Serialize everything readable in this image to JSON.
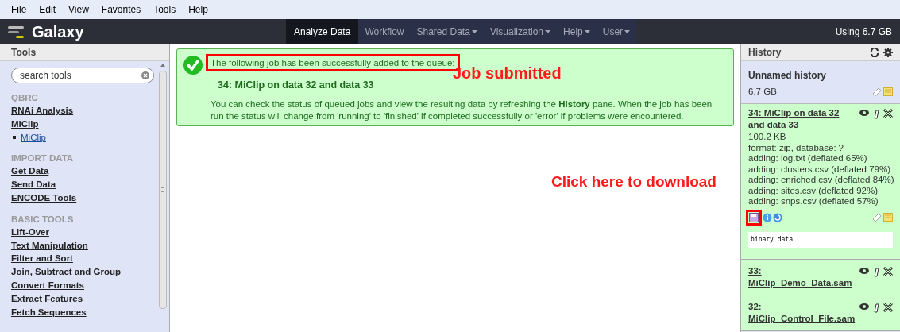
{
  "menu_bar": [
    "File",
    "Edit",
    "View",
    "Favorites",
    "Tools",
    "Help"
  ],
  "brand": "Galaxy",
  "nav_tabs": [
    {
      "label": "Analyze Data",
      "selected": true,
      "kind": "plain"
    },
    {
      "label": "Workflow",
      "selected": false,
      "kind": "plain"
    },
    {
      "label": "Shared Data",
      "selected": false,
      "kind": "dropdown"
    },
    {
      "label": "Visualization",
      "selected": false,
      "kind": "dropdown"
    },
    {
      "label": "Help",
      "selected": false,
      "kind": "dropdown"
    },
    {
      "label": "User",
      "selected": false,
      "kind": "dropdown"
    }
  ],
  "usage": "Using 6.7 GB",
  "tools_panel": {
    "title": "Tools",
    "search": {
      "placeholder": "search tools"
    },
    "sections": [
      {
        "title": "QBRC",
        "items": [
          {
            "label": "RNAi Analysis",
            "kind": "link"
          },
          {
            "label": "MiClip",
            "kind": "link"
          },
          {
            "label": "MiClip",
            "kind": "sub"
          }
        ]
      },
      {
        "title": "IMPORT DATA",
        "items": [
          {
            "label": "Get Data",
            "kind": "link"
          },
          {
            "label": "Send Data",
            "kind": "link"
          },
          {
            "label": "ENCODE Tools",
            "kind": "link"
          }
        ]
      },
      {
        "title": "BASIC TOOLS",
        "items": [
          {
            "label": "Lift-Over",
            "kind": "link"
          },
          {
            "label": "Text Manipulation",
            "kind": "link"
          },
          {
            "label": "Filter and Sort",
            "kind": "link"
          },
          {
            "label": "Join, Subtract and Group",
            "kind": "link"
          },
          {
            "label": "Convert Formats",
            "kind": "link"
          },
          {
            "label": "Extract Features",
            "kind": "link"
          },
          {
            "label": "Fetch Sequences",
            "kind": "link"
          }
        ]
      }
    ]
  },
  "message": {
    "heading": "The following job has been successfully added to the queue:",
    "job": "34: MiClip on data 32 and data 33",
    "body": "You can check the status of queued jobs and view the resulting data by refreshing the **History** pane. When the job has been run the status will change from 'running' to 'finished' if completed successfully or 'error' if problems were encountered."
  },
  "annotations": [
    {
      "text": "Job submitted"
    },
    {
      "text": "Click here to download"
    }
  ],
  "history_panel": {
    "title": "History",
    "name": "Unnamed history",
    "size": "6.7 GB",
    "datasets": [
      {
        "title": "34: MiClip on data 32 and data 33",
        "expanded": true,
        "size": "100.2 KB",
        "format": "format: zip, database:",
        "database": "?",
        "info": [
          "adding: log.txt (deflated 65%)",
          "adding: clusters.csv (deflated 79%)",
          "adding: enriched.csv (deflated 84%)",
          "adding: sites.csv (deflated 92%)",
          "adding: snps.csv (deflated 57%)"
        ],
        "peek": "binary data"
      },
      {
        "title": "33: MiClip_Demo_Data.sam",
        "expanded": false
      },
      {
        "title": "32: MiClip_Control_File.sam",
        "expanded": false
      }
    ]
  }
}
